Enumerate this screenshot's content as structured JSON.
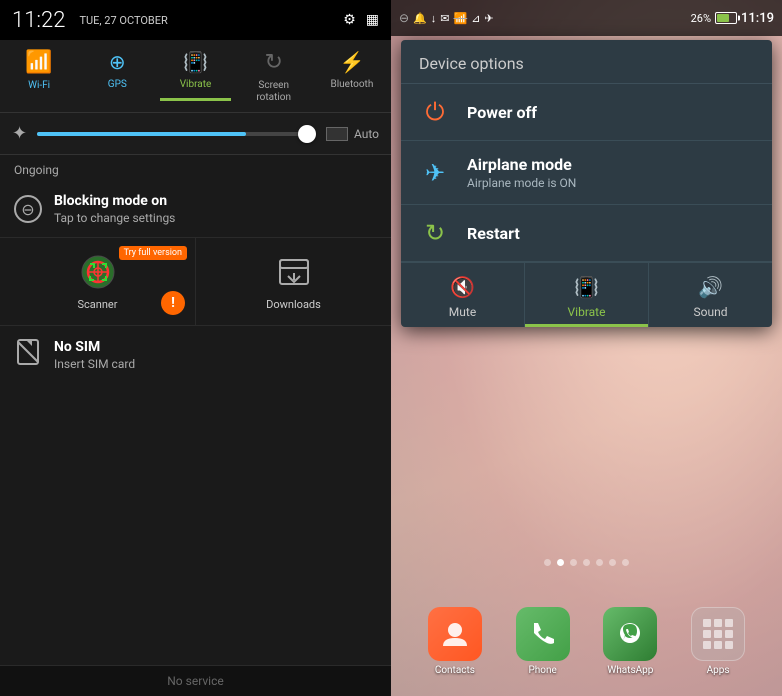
{
  "left": {
    "status_bar": {
      "time": "11:22",
      "date": "TUE, 27 OCTOBER"
    },
    "toggles": [
      {
        "id": "wifi",
        "label": "Wi-Fi",
        "icon": "📶",
        "active": true
      },
      {
        "id": "gps",
        "label": "GPS",
        "icon": "⊕",
        "active": true
      },
      {
        "id": "vibrate",
        "label": "Vibrate",
        "icon": "📳",
        "active": true,
        "vibrate": true
      },
      {
        "id": "screen-rotation",
        "label": "Screen\nrotation",
        "icon": "↻",
        "active": false
      },
      {
        "id": "bluetooth",
        "label": "Bluetooth",
        "icon": "🔷",
        "active": false
      }
    ],
    "brightness": {
      "auto_label": "Auto"
    },
    "ongoing_label": "Ongoing",
    "blocking_mode": {
      "title": "Blocking mode on",
      "subtitle": "Tap to change settings"
    },
    "apps": [
      {
        "label": "Scanner",
        "try_badge": "Try full version"
      },
      {
        "label": "Downloads"
      }
    ],
    "nosim": {
      "title": "No SIM",
      "subtitle": "Insert SIM card"
    },
    "bottom_status": "No service"
  },
  "right": {
    "status_bar": {
      "battery_pct": "26%",
      "time": "11:19"
    },
    "device_options": {
      "title": "Device options",
      "items": [
        {
          "id": "power",
          "label": "Power off",
          "subtitle": ""
        },
        {
          "id": "airplane",
          "label": "Airplane mode",
          "subtitle": "Airplane mode is ON"
        },
        {
          "id": "restart",
          "label": "Restart",
          "subtitle": ""
        }
      ]
    },
    "sound_modes": [
      {
        "id": "mute",
        "label": "Mute",
        "active": false
      },
      {
        "id": "vibrate",
        "label": "Vibrate",
        "active": true
      },
      {
        "id": "sound",
        "label": "Sound",
        "active": false
      }
    ],
    "dock_apps": [
      {
        "id": "contacts",
        "label": "Contacts"
      },
      {
        "id": "phone",
        "label": "Phone"
      },
      {
        "id": "whatsapp",
        "label": "WhatsApp"
      },
      {
        "id": "apps",
        "label": "Apps"
      }
    ]
  }
}
